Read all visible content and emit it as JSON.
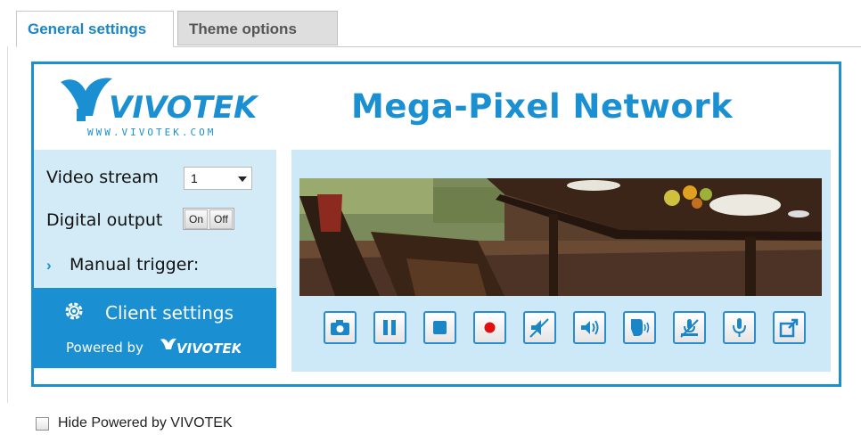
{
  "tabs": [
    {
      "label": "General settings",
      "active": true
    },
    {
      "label": "Theme options",
      "active": false
    }
  ],
  "preview": {
    "logo_text": "VIVOTEK",
    "logo_url_text": "WWW.VIVOTEK.COM",
    "banner_title": "Mega-Pixel Network",
    "video_stream_label": "Video stream",
    "video_stream_value": "1",
    "digital_output_label": "Digital output",
    "on_label": "On",
    "off_label": "Off",
    "manual_trigger_label": "Manual trigger:",
    "client_settings_label": "Client settings",
    "powered_by_label": "Powered by",
    "powered_by_brand": "VIVOTEK"
  },
  "controls": [
    {
      "icon": "camera-icon"
    },
    {
      "icon": "pause-icon"
    },
    {
      "icon": "stop-icon"
    },
    {
      "icon": "record-icon"
    },
    {
      "icon": "volume-mute-icon"
    },
    {
      "icon": "volume-icon"
    },
    {
      "icon": "talk-icon"
    },
    {
      "icon": "mic-mute-icon"
    },
    {
      "icon": "mic-icon"
    },
    {
      "icon": "fullscreen-icon"
    }
  ],
  "hide_powered": {
    "label": "Hide Powered by VIVOTEK",
    "checked": false
  },
  "colors": {
    "accent": "#1a90d2",
    "panel_bg": "#d3ebf7",
    "video_panel_bg": "#cde8f6"
  }
}
